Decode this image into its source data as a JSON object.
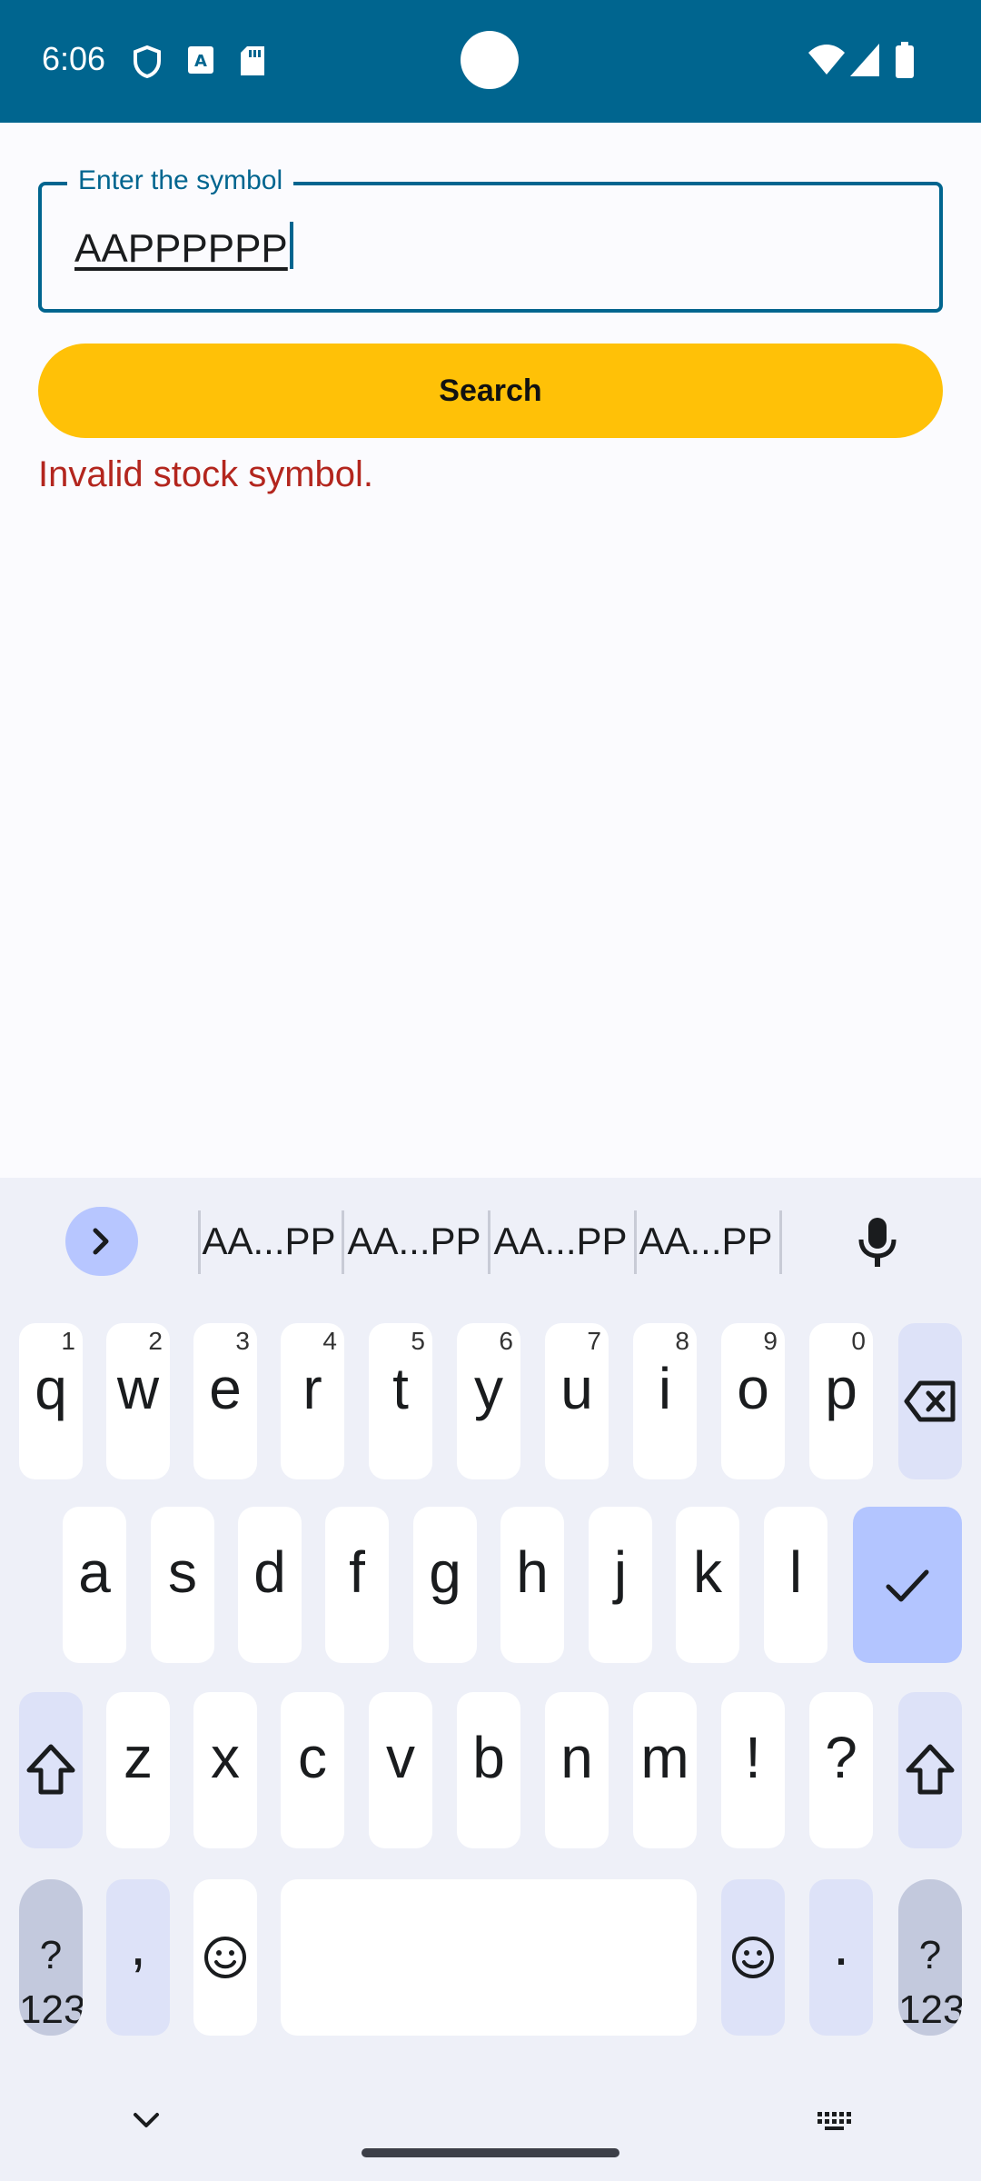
{
  "status": {
    "time": "6:06"
  },
  "form": {
    "label": "Enter the symbol",
    "value": "AAPPPPPP",
    "search_label": "Search",
    "error": "Invalid stock symbol."
  },
  "keyboard": {
    "suggestions": [
      "AA...PP",
      "AA...PP",
      "AA...PP",
      "AA...PP"
    ],
    "row1": [
      {
        "ch": "q",
        "num": "1"
      },
      {
        "ch": "w",
        "num": "2"
      },
      {
        "ch": "e",
        "num": "3"
      },
      {
        "ch": "r",
        "num": "4"
      },
      {
        "ch": "t",
        "num": "5"
      },
      {
        "ch": "y",
        "num": "6"
      },
      {
        "ch": "u",
        "num": "7"
      },
      {
        "ch": "i",
        "num": "8"
      },
      {
        "ch": "o",
        "num": "9"
      },
      {
        "ch": "p",
        "num": "0"
      }
    ],
    "row2": [
      "a",
      "s",
      "d",
      "f",
      "g",
      "h",
      "j",
      "k",
      "l"
    ],
    "row3": [
      "z",
      "x",
      "c",
      "v",
      "b",
      "n",
      "m",
      "!",
      "?"
    ],
    "symbols_label": "?123",
    "comma": ",",
    "period": "."
  },
  "colors": {
    "accent": "#00658f",
    "button": "#ffc107",
    "error": "#b3261e"
  }
}
